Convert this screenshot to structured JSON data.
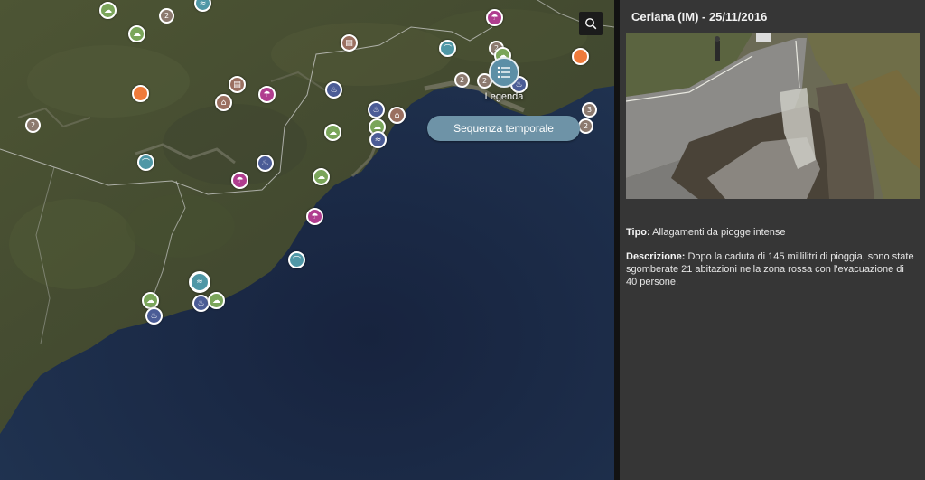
{
  "map": {
    "legend_label": "Legenda",
    "timeline_label": "Sequenza temporale",
    "search_icon": "search-icon",
    "legend_icon": "list-icon",
    "cluster_labels": {
      "c1": "2",
      "c2": "2",
      "c3": "2",
      "c4": "2",
      "c5": "2",
      "c6": "3",
      "c7": "2",
      "c8": "2"
    }
  },
  "panel": {
    "title": "Ceriana (IM) - 25/11/2016",
    "type_label": "Tipo:",
    "type_value": " Allagamenti da piogge intense",
    "description_label": "Descrizione:",
    "description_value": " Dopo la caduta di 145 millilitri di pioggia, sono state sgomberate 21 abitazioni nella zona rossa con l'evacuazione di 40 persone."
  },
  "colors": {
    "sea": "#1a2a44",
    "land": "#4a5236",
    "panel_bg": "#363636",
    "timeline_button": "#6e93a7",
    "legend_button": "#5c8fa6"
  }
}
